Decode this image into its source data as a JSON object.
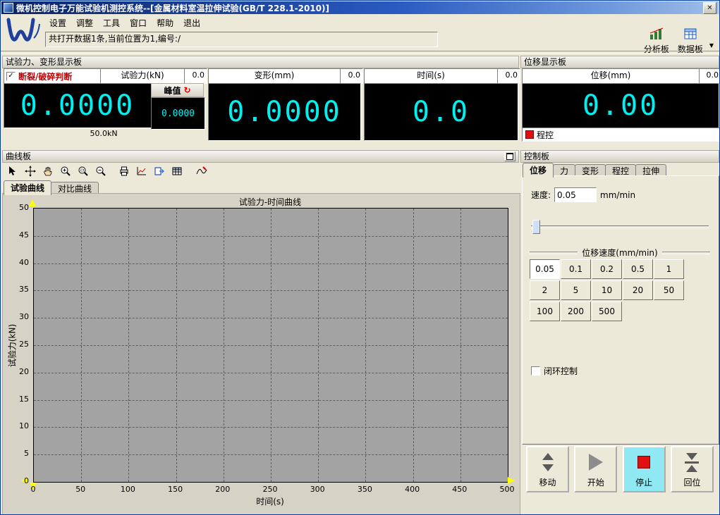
{
  "window": {
    "title": "微机控制电子万能试验机测控系统--[金属材料室温拉伸试验(GB/T 228.1-2010)]",
    "close_glyph": "✕"
  },
  "menu": {
    "items": [
      "设置",
      "调整",
      "工具",
      "窗口",
      "帮助",
      "退出"
    ]
  },
  "toolbar": {
    "status_text": "共打开数据1条,当前位置为1,编号:/",
    "analysis_label": "分析板",
    "data_label": "数据板",
    "overflow_glyph": "▼"
  },
  "display_panel": {
    "title": "试验力、变形显示板",
    "fracture_label": "断裂/破碎判断",
    "check_glyph": "✓",
    "force": {
      "header": "试验力(kN)",
      "rate": "0.0",
      "value": "0.0000",
      "peak_label": "峰值",
      "peak_refresh_glyph": "↻",
      "peak_value": "0.0000",
      "range": "50.0kN"
    },
    "deform": {
      "header": "变形(mm)",
      "rate": "0.0",
      "value": "0.0000"
    },
    "time": {
      "header": "时间(s)",
      "rate": "0.0",
      "value": "0.0"
    }
  },
  "displacement_panel": {
    "title": "位移显示板",
    "header": "位移(mm)",
    "rate": "0.0",
    "value": "0.00",
    "program_label": "程控"
  },
  "curve_panel": {
    "title": "曲线板",
    "toolbar_icons": [
      "select",
      "move-cross",
      "hand",
      "zoom-in",
      "zoom-window",
      "zoom-out",
      "print",
      "report",
      "export",
      "table",
      "marker"
    ],
    "tabs": [
      "试验曲线",
      "对比曲线"
    ],
    "active_tab": "试验曲线"
  },
  "chart_data": {
    "type": "line",
    "title": "试验力-时间曲线",
    "xlabel": "时间(s)",
    "ylabel": "试验力(kN)",
    "xlim": [
      0,
      500
    ],
    "ylim": [
      0,
      50
    ],
    "x_ticks": [
      0,
      50,
      100,
      150,
      200,
      250,
      300,
      350,
      400,
      450,
      500
    ],
    "y_ticks": [
      0,
      5,
      10,
      15,
      20,
      25,
      30,
      35,
      40,
      45,
      50
    ],
    "grid": true,
    "legend_position": "none",
    "plot_bg": "#A3A3A3",
    "series": []
  },
  "control_panel": {
    "title": "控制板",
    "tabs": [
      "位移",
      "力",
      "变形",
      "程控",
      "拉伸"
    ],
    "active_tab": "位移",
    "speed_label": "速度:",
    "speed_value": "0.05",
    "speed_unit": "mm/min",
    "group_title": "位移速度(mm/min)",
    "speed_options": [
      "0.05",
      "0.1",
      "0.2",
      "0.5",
      "1",
      "2",
      "5",
      "10",
      "20",
      "50",
      "100",
      "200",
      "500"
    ],
    "selected_speed": "0.05",
    "closed_loop_label": "闭环控制",
    "closed_loop_checked": false,
    "action_buttons": [
      {
        "name": "move",
        "label": "移动",
        "active": false
      },
      {
        "name": "start",
        "label": "开始",
        "active": false
      },
      {
        "name": "stop",
        "label": "停止",
        "active": true
      },
      {
        "name": "return",
        "label": "回位",
        "active": false
      }
    ]
  },
  "colors": {
    "lcd_text": "#00EFEF",
    "lcd_bg": "#000000",
    "stop_red": "#E01010",
    "stop_button_bg": "#8FE8F2",
    "plot_bg": "#A3A3A3",
    "axis_arrow": "#FFFF00",
    "fracture_text": "#C00000"
  }
}
